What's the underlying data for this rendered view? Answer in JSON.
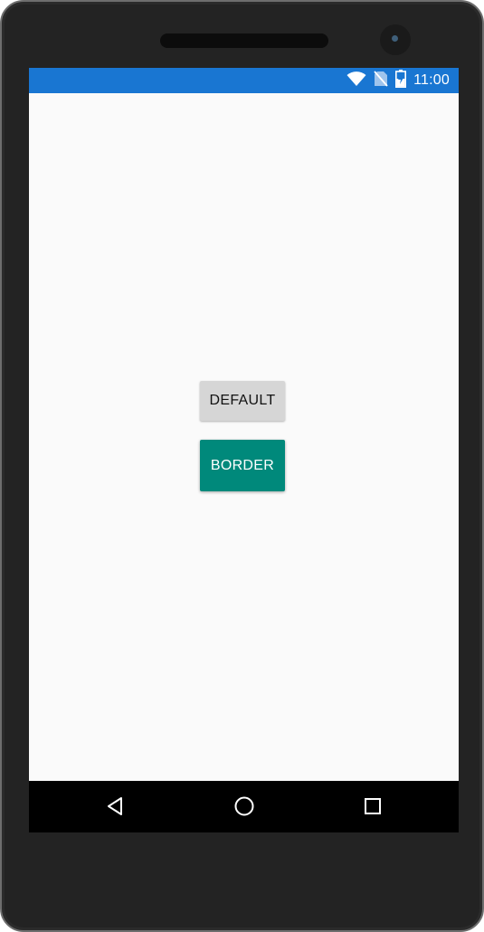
{
  "status_bar": {
    "time": "11:00",
    "color": "#1976d2",
    "icons": [
      "wifi-icon",
      "no-sim-icon",
      "battery-charging-icon"
    ]
  },
  "content": {
    "default_button_label": "DEFAULT",
    "border_button_label": "BORDER",
    "border_button_color": "#00897b"
  },
  "nav_bar": {
    "buttons": [
      "back-icon",
      "home-icon",
      "recents-icon"
    ]
  }
}
